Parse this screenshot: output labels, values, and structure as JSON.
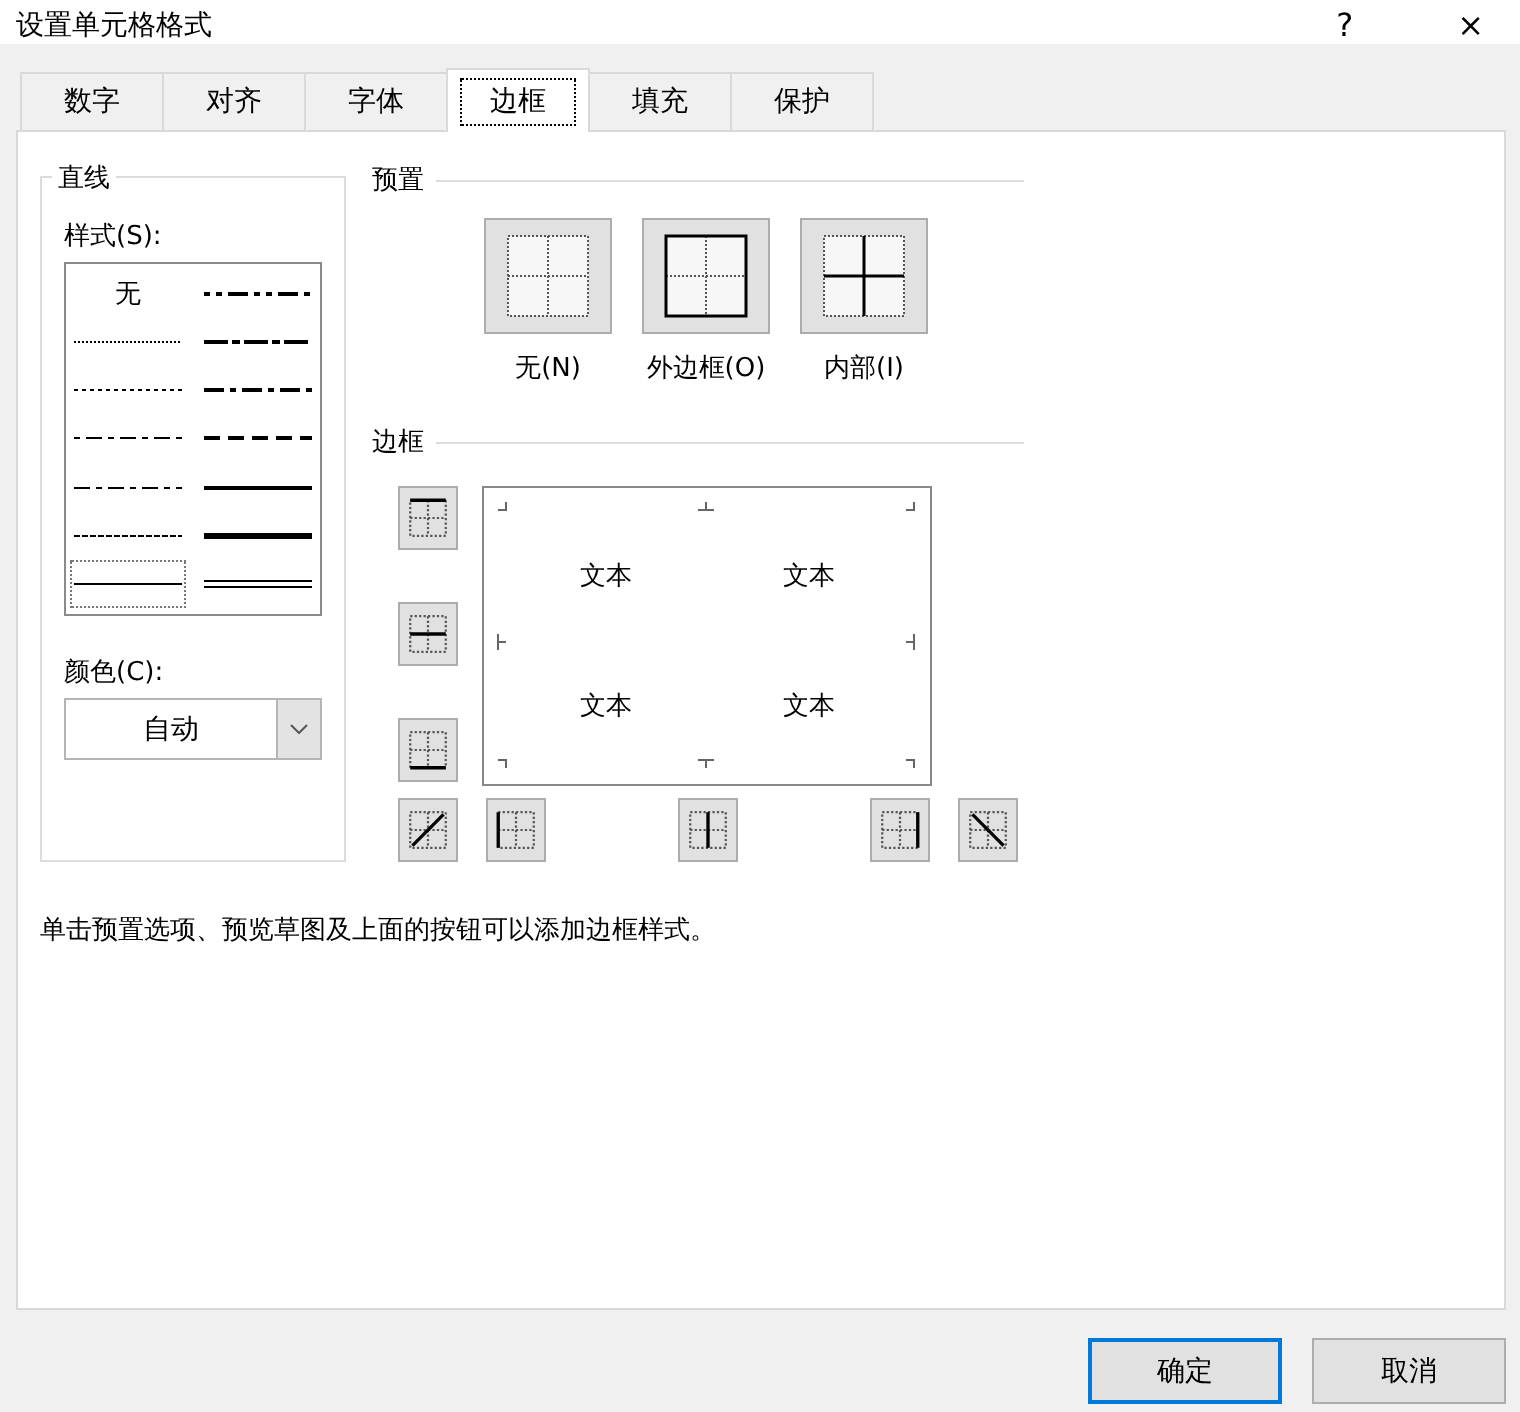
{
  "window": {
    "title": "设置单元格格式",
    "help": "?",
    "close": "×"
  },
  "tabs": [
    {
      "label": "数字",
      "selected": false
    },
    {
      "label": "对齐",
      "selected": false
    },
    {
      "label": "字体",
      "selected": false
    },
    {
      "label": "边框",
      "selected": true
    },
    {
      "label": "填充",
      "selected": false
    },
    {
      "label": "保护",
      "selected": false
    }
  ],
  "line": {
    "title": "直线",
    "style_label": "样式(S):",
    "styles": [
      {
        "kind": "none",
        "label": "无",
        "selected": false
      },
      {
        "kind": "hair",
        "selected": false
      },
      {
        "kind": "dotted",
        "selected": false
      },
      {
        "kind": "dash-dot-dot",
        "selected": false
      },
      {
        "kind": "dash-dot",
        "selected": false
      },
      {
        "kind": "dashed",
        "selected": false
      },
      {
        "kind": "thin",
        "selected": true
      },
      {
        "kind": "medium-dash-dot-dot",
        "selected": false
      },
      {
        "kind": "slant-dash-dot",
        "selected": false
      },
      {
        "kind": "medium-dash-dot",
        "selected": false
      },
      {
        "kind": "medium-dashed",
        "selected": false
      },
      {
        "kind": "medium",
        "selected": false
      },
      {
        "kind": "thick",
        "selected": false
      },
      {
        "kind": "double",
        "selected": false
      }
    ],
    "color_label": "颜色(C):",
    "color_value": "自动"
  },
  "presets": {
    "title": "预置",
    "items": [
      {
        "kind": "none",
        "label": "无(N)"
      },
      {
        "kind": "outline",
        "label": "外边框(O)"
      },
      {
        "kind": "inside",
        "label": "内部(I)"
      }
    ]
  },
  "border": {
    "title": "边框",
    "preview_texts": [
      "文本",
      "文本",
      "文本",
      "文本"
    ],
    "side_buttons": [
      {
        "kind": "top"
      },
      {
        "kind": "middle-horizontal"
      },
      {
        "kind": "bottom"
      }
    ],
    "bottom_buttons": [
      {
        "kind": "diagonal-up"
      },
      {
        "kind": "left"
      },
      {
        "kind": "middle-vertical"
      },
      {
        "kind": "right"
      },
      {
        "kind": "diagonal-down"
      }
    ]
  },
  "hint": "单击预置选项、预览草图及上面的按钮可以添加边框样式。",
  "buttons": [
    {
      "label": "确定",
      "default": true
    },
    {
      "label": "取消",
      "default": false
    }
  ]
}
